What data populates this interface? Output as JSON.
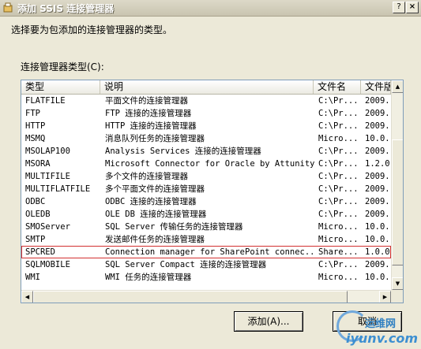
{
  "window": {
    "title": "添加 SSIS 连接管理器",
    "help_glyph": "?",
    "close_glyph": "×"
  },
  "instruction": "选择要为包添加的连接管理器的类型。",
  "list_label": "连接管理器类型(C):",
  "columns": [
    "类型",
    "说明",
    "文件名",
    "文件版"
  ],
  "rows": [
    [
      "FLATFILE",
      "平面文件的连接管理器",
      "C:\\Pr...",
      "2009."
    ],
    [
      "FTP",
      "FTP 连接的连接管理器",
      "C:\\Pr...",
      "2009."
    ],
    [
      "HTTP",
      "HTTP 连接的连接管理器",
      "C:\\Pr...",
      "2009."
    ],
    [
      "MSMQ",
      "消息队列任务的连接管理器",
      "Micro...",
      "10.0."
    ],
    [
      "MSOLAP100",
      "Analysis Services 连接的连接管理器",
      "C:\\Pr...",
      "2009."
    ],
    [
      "MSORA",
      "Microsoft Connector for Oracle by Attunity",
      "C:\\Pr...",
      "1.2.0"
    ],
    [
      "MULTIFILE",
      "多个文件的连接管理器",
      "C:\\Pr...",
      "2009."
    ],
    [
      "MULTIFLATFILE",
      "多个平面文件的连接管理器",
      "C:\\Pr...",
      "2009."
    ],
    [
      "ODBC",
      "ODBC 连接的连接管理器",
      "C:\\Pr...",
      "2009."
    ],
    [
      "OLEDB",
      "OLE DB 连接的连接管理器",
      "C:\\Pr...",
      "2009."
    ],
    [
      "SMOServer",
      "SQL Server 传输任务的连接管理器",
      "Micro...",
      "10.0."
    ],
    [
      "SMTP",
      "发送邮件任务的连接管理器",
      "Micro...",
      "10.0."
    ],
    [
      "SPCRED",
      "Connection manager for SharePoint connec...",
      "Share...",
      "1.0.0"
    ],
    [
      "SQLMOBILE",
      "SQL Server Compact 连接的连接管理器",
      "C:\\Pr...",
      "2009."
    ],
    [
      "WMI",
      "WMI 任务的连接管理器",
      "Micro...",
      "10.0."
    ]
  ],
  "selected_row": "SPCRED",
  "buttons": {
    "add": "添加(A)...",
    "cancel": "取消"
  },
  "watermark": {
    "main": "运维网",
    "sub": "iyunv.com"
  },
  "colors": {
    "dialog_bg": "#ece9d8",
    "selection_outline": "#d23030"
  }
}
